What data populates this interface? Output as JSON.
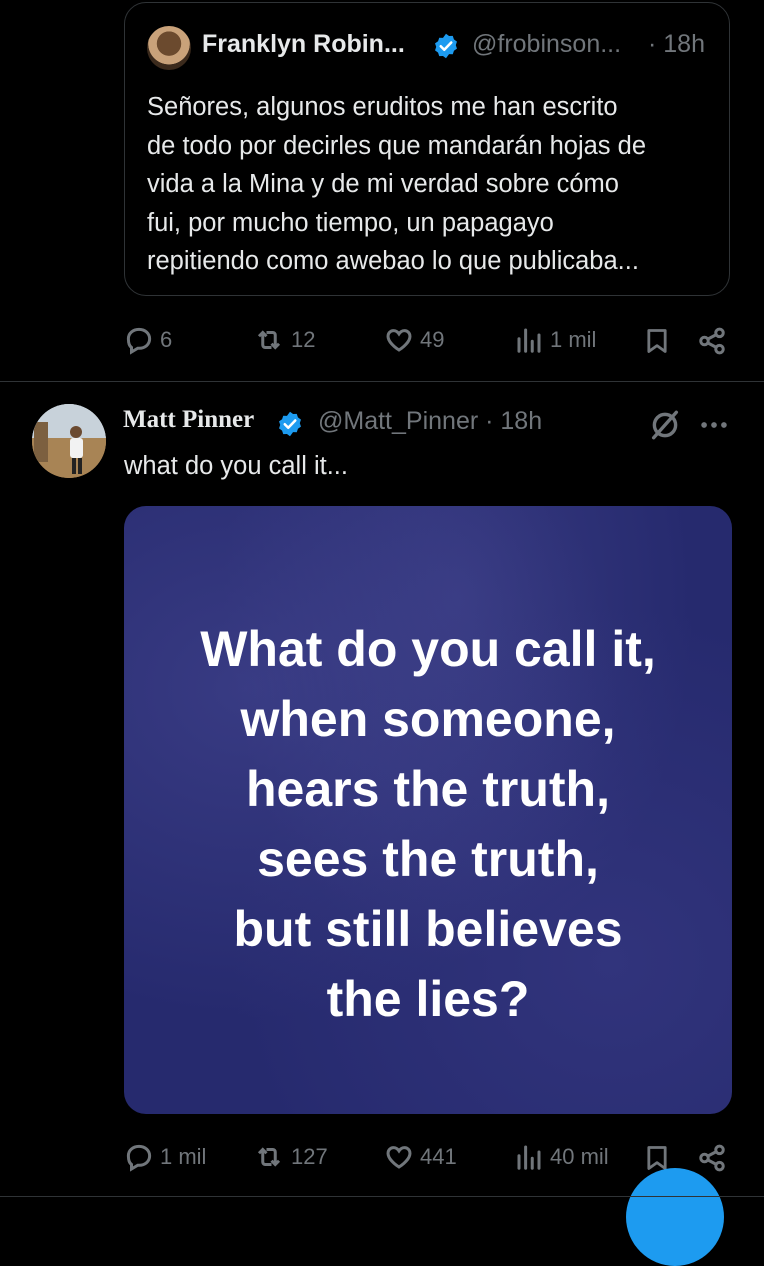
{
  "quoted_post": {
    "author_name": "Franklyn Robin...",
    "handle": "@frobinson...",
    "separator": "·",
    "time": "18h",
    "text": "Señores, algunos eruditos me han escrito\nde todo por decirles que mandarán hojas de\nvida a la Mina y de mi verdad sobre cómo\nfui, por mucho tiempo, un papagayo\nrepitiendo como awebao lo que publicaba..."
  },
  "quoted_post_actions": {
    "replies": "6",
    "reposts": "12",
    "likes": "49",
    "views": "1 mil"
  },
  "post": {
    "author_name": "Matt Pinner",
    "handle": "@Matt_Pinner",
    "separator": "·",
    "time": "18h",
    "text": "what do you call it...",
    "image_text": "What do you call it,\nwhen someone,\nhears the truth,\nsees the truth,\nbut still believes\nthe lies?"
  },
  "post_actions": {
    "replies": "1 mil",
    "reposts": "127",
    "likes": "441",
    "views": "40 mil"
  },
  "icons": {
    "verified": "verified-badge-icon",
    "reply": "reply-icon",
    "repost": "repost-icon",
    "like": "heart-icon",
    "views": "views-icon",
    "bookmark": "bookmark-icon",
    "share": "share-icon",
    "grok": "grok-icon",
    "more": "more-icon"
  },
  "colors": {
    "background": "#000000",
    "text": "#e7e9ea",
    "muted": "#71767b",
    "accent": "#1d9bf0",
    "media_bg": "#262a6e"
  }
}
